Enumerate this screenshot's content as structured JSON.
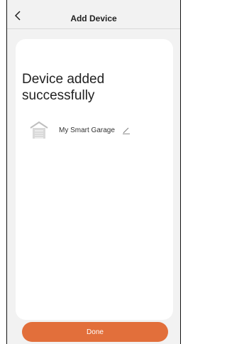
{
  "header": {
    "title": "Add Device",
    "back_icon": "chevron-left-icon"
  },
  "main": {
    "success_message": "Device added successfully",
    "device": {
      "name": "My Smart Garage",
      "icon": "garage-icon",
      "edit_icon": "pencil-icon"
    }
  },
  "footer": {
    "done_label": "Done"
  },
  "colors": {
    "accent": "#e26f3b",
    "background": "#f2f2f2",
    "card": "#ffffff"
  }
}
